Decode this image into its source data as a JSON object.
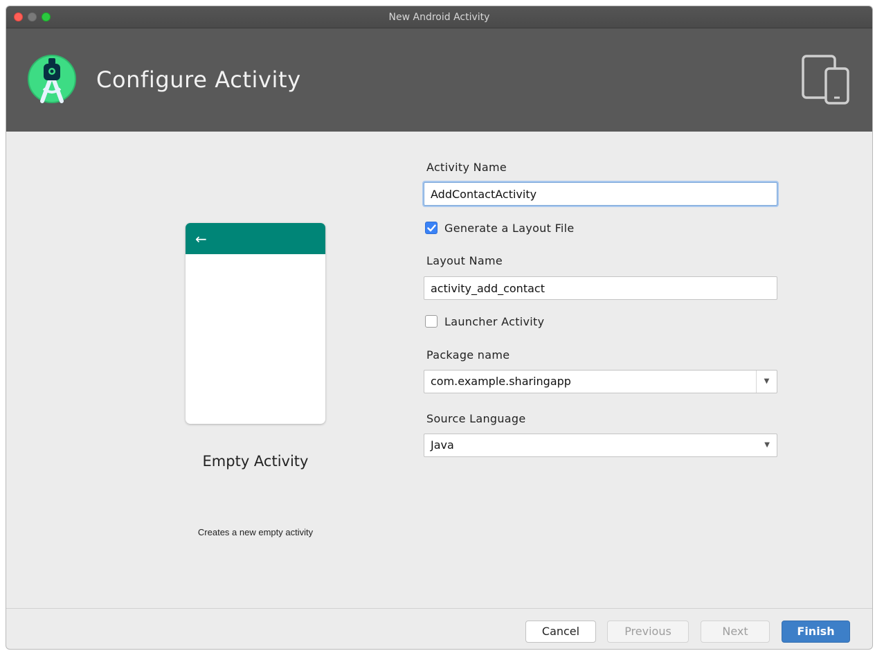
{
  "window": {
    "title": "New Android Activity"
  },
  "banner": {
    "title": "Configure Activity",
    "logo_icon": "android-studio-logo",
    "device_icon": "tablet-phone-icon",
    "background": "#595959"
  },
  "preview": {
    "back_arrow": "←",
    "toolbar_color": "#008577",
    "name": "Empty Activity",
    "description": "Creates a new empty activity"
  },
  "form": {
    "activity_name_label": "Activity Name",
    "activity_name_value": "AddContactActivity",
    "generate_layout_label": "Generate a Layout File",
    "generate_layout_checked": true,
    "layout_name_label": "Layout Name",
    "layout_name_value": "activity_add_contact",
    "launcher_activity_label": "Launcher Activity",
    "launcher_activity_checked": false,
    "package_name_label": "Package name",
    "package_name_value": "com.example.sharingapp",
    "source_language_label": "Source Language",
    "source_language_value": "Java"
  },
  "footer": {
    "cancel_label": "Cancel",
    "previous_label": "Previous",
    "next_label": "Next",
    "finish_label": "Finish",
    "accent_color": "#3d7fc8"
  }
}
